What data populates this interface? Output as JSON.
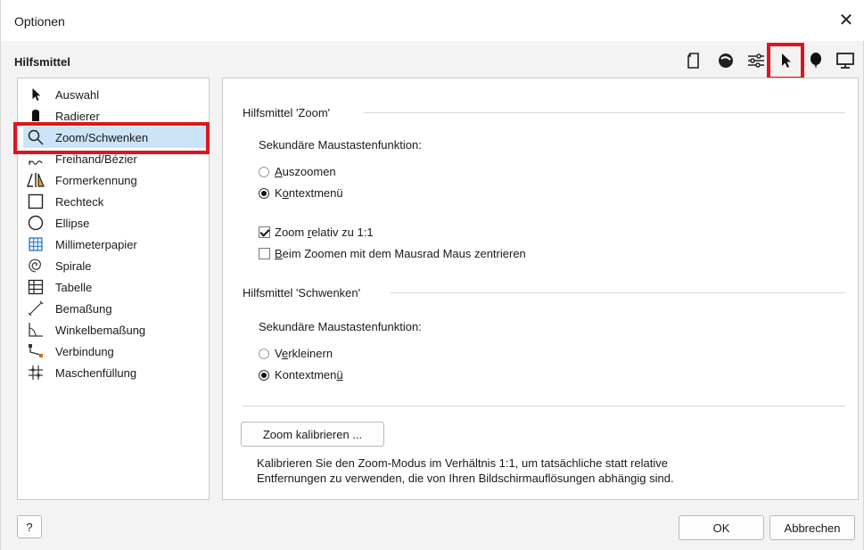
{
  "window": {
    "title": "Optionen",
    "close": "✕"
  },
  "section": {
    "title": "Hilfsmittel"
  },
  "toolbar": {
    "icons": [
      "document-icon",
      "color-ball-icon",
      "sliders-icon",
      "pointer-icon",
      "balloon-icon",
      "monitor-icon"
    ],
    "highlight_color": "#e0141e"
  },
  "nav": {
    "items": [
      {
        "label": "Auswahl",
        "icon": "pointer-icon"
      },
      {
        "label": "Radierer",
        "icon": "eraser-icon"
      },
      {
        "label": "Zoom/Schwenken",
        "icon": "magnifier-icon"
      },
      {
        "label": "Freihand/Bézier",
        "icon": "freehand-icon"
      },
      {
        "label": "Formerkennung",
        "icon": "shape-recognition-icon"
      },
      {
        "label": "Rechteck",
        "icon": "rectangle-icon"
      },
      {
        "label": "Ellipse",
        "icon": "ellipse-icon"
      },
      {
        "label": "Millimeterpapier",
        "icon": "graph-paper-icon"
      },
      {
        "label": "Spirale",
        "icon": "spiral-icon"
      },
      {
        "label": "Tabelle",
        "icon": "table-icon"
      },
      {
        "label": "Bemaßung",
        "icon": "dimension-icon"
      },
      {
        "label": "Winkelbemaßung",
        "icon": "angle-dimension-icon"
      },
      {
        "label": "Verbindung",
        "icon": "connector-icon"
      },
      {
        "label": "Maschenfüllung",
        "icon": "mesh-fill-icon"
      }
    ],
    "selected": "Zoom/Schwenken",
    "selected_bg": "#cce4f7"
  },
  "zoom": {
    "group_label": "Hilfsmittel 'Zoom'",
    "secondary_label": "Sekundäre Maustastenfunktion:",
    "radio1_pre": "",
    "radio1_u": "A",
    "radio1_post": "uszoomen",
    "radio2_pre": "K",
    "radio2_u": "o",
    "radio2_post": "ntextmenü",
    "check1_pre": "Zoom ",
    "check1_u": "r",
    "check1_post": "elativ zu 1:1",
    "check2_pre": "",
    "check2_u": "B",
    "check2_post": "eim Zoomen mit dem Mausrad Maus zentrieren"
  },
  "pan": {
    "group_label": "Hilfsmittel 'Schwenken'",
    "secondary_label": "Sekundäre Maustastenfunktion:",
    "radio1_pre": "V",
    "radio1_u": "e",
    "radio1_post": "rkleinern",
    "radio2_pre": "Kontextmen",
    "radio2_u": "ü",
    "radio2_post": ""
  },
  "calibrate": {
    "button": "Zoom kalibrieren ...",
    "desc_line1": "Kalibrieren Sie den Zoom-Modus im Verhältnis 1:1, um tatsächliche statt relative",
    "desc_line2": "Entfernungen zu verwenden, die von Ihren Bildschirmauflösungen abhängig sind."
  },
  "footer": {
    "help": "?",
    "ok": "OK",
    "cancel": "Abbrechen"
  }
}
